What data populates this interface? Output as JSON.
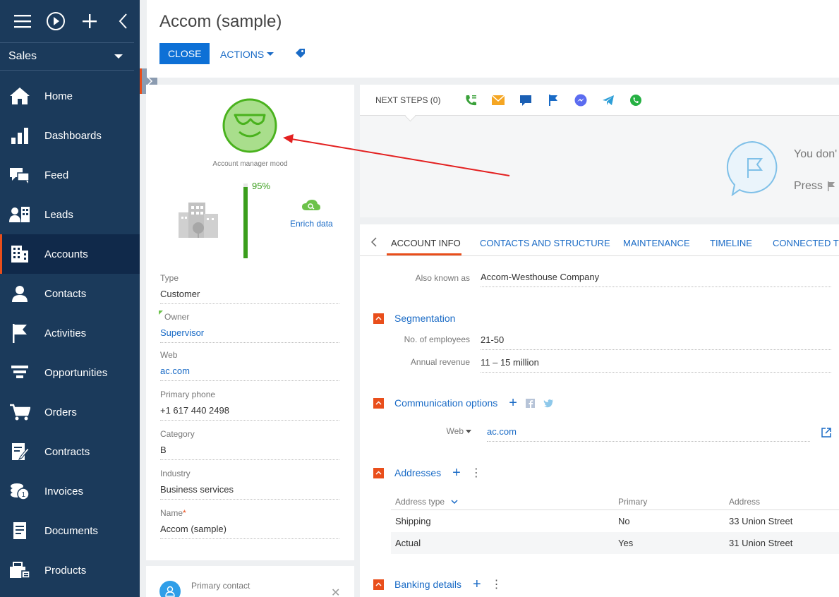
{
  "workspace": "Sales",
  "nav": [
    {
      "label": "Home",
      "icon": "home-icon"
    },
    {
      "label": "Dashboards",
      "icon": "dashboards-icon"
    },
    {
      "label": "Feed",
      "icon": "feed-icon"
    },
    {
      "label": "Leads",
      "icon": "leads-icon"
    },
    {
      "label": "Accounts",
      "icon": "accounts-icon"
    },
    {
      "label": "Contacts",
      "icon": "contacts-icon"
    },
    {
      "label": "Activities",
      "icon": "activities-icon"
    },
    {
      "label": "Opportunities",
      "icon": "opportunities-icon"
    },
    {
      "label": "Orders",
      "icon": "orders-icon"
    },
    {
      "label": "Contracts",
      "icon": "contracts-icon"
    },
    {
      "label": "Invoices",
      "icon": "invoices-icon"
    },
    {
      "label": "Documents",
      "icon": "documents-icon"
    },
    {
      "label": "Products",
      "icon": "products-icon"
    }
  ],
  "header": {
    "title": "Accom (sample)",
    "close_label": "CLOSE",
    "actions_label": "ACTIONS"
  },
  "profile": {
    "mood_label": "Account manager mood",
    "completeness_pct": "95%",
    "completeness": 0.95,
    "enrich_label": "Enrich data",
    "fields": [
      {
        "label": "Type",
        "value": "Customer"
      },
      {
        "label": "Owner",
        "value": "Supervisor"
      },
      {
        "label": "Web",
        "value": "ac.com"
      },
      {
        "label": "Primary phone",
        "value": "+1 617 440 2498"
      },
      {
        "label": "Category",
        "value": "B"
      },
      {
        "label": "Industry",
        "value": "Business services"
      },
      {
        "label": "Name",
        "value": "Accom (sample)"
      }
    ],
    "primary_contact_label": "Primary contact"
  },
  "next_steps": {
    "tab_label": "NEXT STEPS (0)",
    "empty_text1": "You don'",
    "empty_text2": "Press"
  },
  "tabs": [
    "ACCOUNT INFO",
    "CONTACTS AND STRUCTURE",
    "MAINTENANCE",
    "TIMELINE",
    "CONNECTED TO"
  ],
  "account_info": {
    "aka_label": "Also known as",
    "aka_value": "Accom-Westhouse Company",
    "segmentation_title": "Segmentation",
    "employees_label": "No. of employees",
    "employees_value": "21-50",
    "revenue_label": "Annual revenue",
    "revenue_value": "11 – 15 million",
    "comm_title": "Communication options",
    "web_label": "Web",
    "web_value": "ac.com",
    "addresses_title": "Addresses",
    "addr_headers": [
      "Address type",
      "Primary",
      "Address"
    ],
    "addr_rows": [
      [
        "Shipping",
        "No",
        "33 Union Street"
      ],
      [
        "Actual",
        "Yes",
        "31 Union Street"
      ]
    ],
    "banking_title": "Banking details"
  },
  "colors": {
    "sidebar": "#1b3a5b",
    "accent": "#e94e1b",
    "primary": "#0d70d6",
    "link": "#1a6bc6",
    "success": "#3a9e1c"
  }
}
